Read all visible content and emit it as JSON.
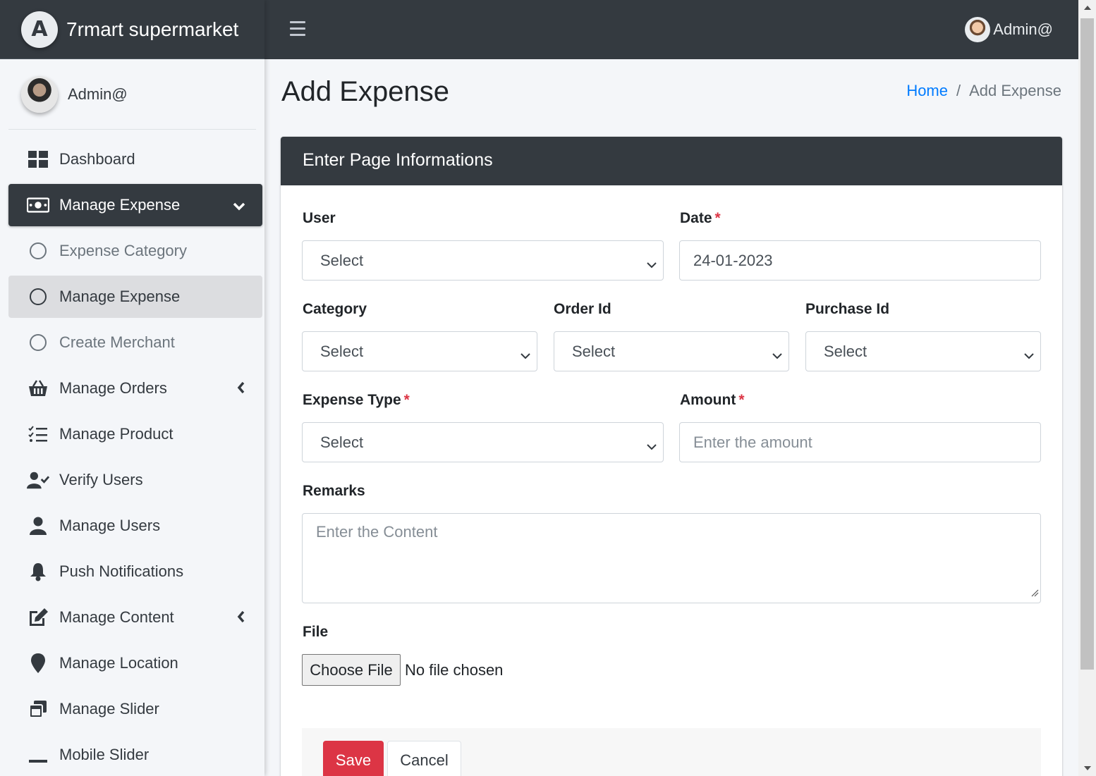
{
  "brand": {
    "name": "7rmart supermarket",
    "logo_letter": "A"
  },
  "sidebar": {
    "user_name": "Admin@",
    "items": [
      {
        "label": "Dashboard",
        "icon": "dashboard-icon"
      },
      {
        "label": "Manage Expense",
        "icon": "money-bill-icon",
        "active": true,
        "expanded": true
      },
      {
        "label": "Expense Category",
        "icon": "circle-icon",
        "sub": true
      },
      {
        "label": "Manage Expense",
        "icon": "circle-icon",
        "sub": true,
        "current": true
      },
      {
        "label": "Create Merchant",
        "icon": "circle-icon",
        "sub": true
      },
      {
        "label": "Manage Orders",
        "icon": "basket-icon",
        "has_children": true
      },
      {
        "label": "Manage Product",
        "icon": "tasks-icon"
      },
      {
        "label": "Verify Users",
        "icon": "user-check-icon"
      },
      {
        "label": "Manage Users",
        "icon": "user-icon"
      },
      {
        "label": "Push Notifications",
        "icon": "bell-icon"
      },
      {
        "label": "Manage Content",
        "icon": "edit-icon",
        "has_children": true
      },
      {
        "label": "Manage Location",
        "icon": "map-marker-icon"
      },
      {
        "label": "Manage Slider",
        "icon": "window-restore-icon"
      },
      {
        "label": "Mobile Slider",
        "icon": "minus-icon"
      }
    ]
  },
  "topbar": {
    "user_name": "Admin@"
  },
  "page": {
    "title": "Add Expense",
    "breadcrumb": {
      "home": "Home",
      "separator": "/",
      "current": "Add Expense"
    }
  },
  "form": {
    "header": "Enter Page Informations",
    "user": {
      "label": "User",
      "value": "Select"
    },
    "date": {
      "label": "Date",
      "required_mark": "*",
      "value": "24-01-2023"
    },
    "category": {
      "label": "Category",
      "value": "Select"
    },
    "order_id": {
      "label": "Order Id",
      "value": "Select"
    },
    "purchase_id": {
      "label": "Purchase Id",
      "value": "Select"
    },
    "expense_type": {
      "label": "Expense Type",
      "required_mark": "*",
      "value": "Select"
    },
    "amount": {
      "label": "Amount",
      "required_mark": "*",
      "placeholder": "Enter the amount"
    },
    "remarks": {
      "label": "Remarks",
      "placeholder": "Enter the Content"
    },
    "file": {
      "label": "File",
      "button": "Choose File",
      "status": "No file chosen"
    },
    "save": "Save",
    "cancel": "Cancel"
  },
  "colors": {
    "dark": "#343a40",
    "danger": "#dc3545",
    "link": "#007bff",
    "background": "#f4f6f9"
  }
}
